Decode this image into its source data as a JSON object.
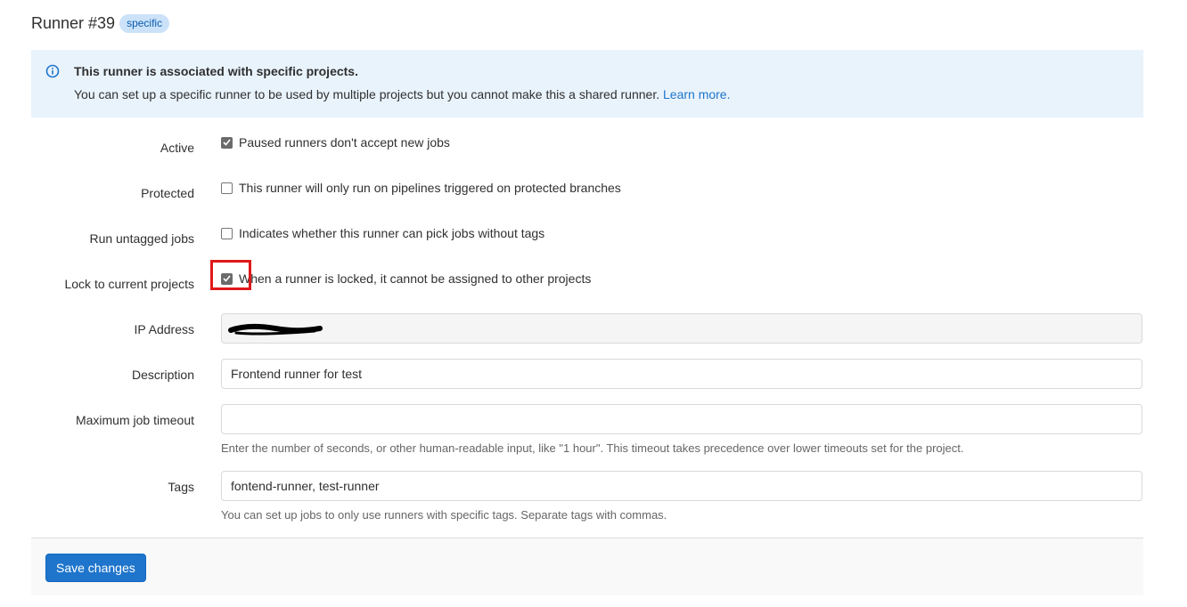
{
  "header": {
    "title": "Runner #39",
    "badge": "specific"
  },
  "alert": {
    "icon": "info-icon",
    "title": "This runner is associated with specific projects.",
    "body": "You can set up a specific runner to be used by multiple projects but you cannot make this a shared runner.",
    "link": "Learn more."
  },
  "form": {
    "active": {
      "label": "Active",
      "text": "Paused runners don't accept new jobs",
      "checked": true
    },
    "protected": {
      "label": "Protected",
      "text": "This runner will only run on pipelines triggered on protected branches",
      "checked": false
    },
    "untagged": {
      "label": "Run untagged jobs",
      "text": "Indicates whether this runner can pick jobs without tags",
      "checked": false
    },
    "locked": {
      "label": "Lock to current projects",
      "text": "When a runner is locked, it cannot be assigned to other projects",
      "checked": true
    },
    "ip": {
      "label": "IP Address",
      "value": ""
    },
    "description": {
      "label": "Description",
      "value": "Frontend runner for test"
    },
    "timeout": {
      "label": "Maximum job timeout",
      "value": "",
      "help": "Enter the number of seconds, or other human-readable input, like \"1 hour\". This timeout takes precedence over lower timeouts set for the project."
    },
    "tags": {
      "label": "Tags",
      "value": "fontend-runner, test-runner",
      "help": "You can set up jobs to only use runners with specific tags. Separate tags with commas."
    }
  },
  "footer": {
    "save_label": "Save changes"
  },
  "colors": {
    "accent": "#1f75cb",
    "alert_bg": "#e9f3fc",
    "badge_bg": "#cbe2f9",
    "highlight": "#e0191a"
  }
}
